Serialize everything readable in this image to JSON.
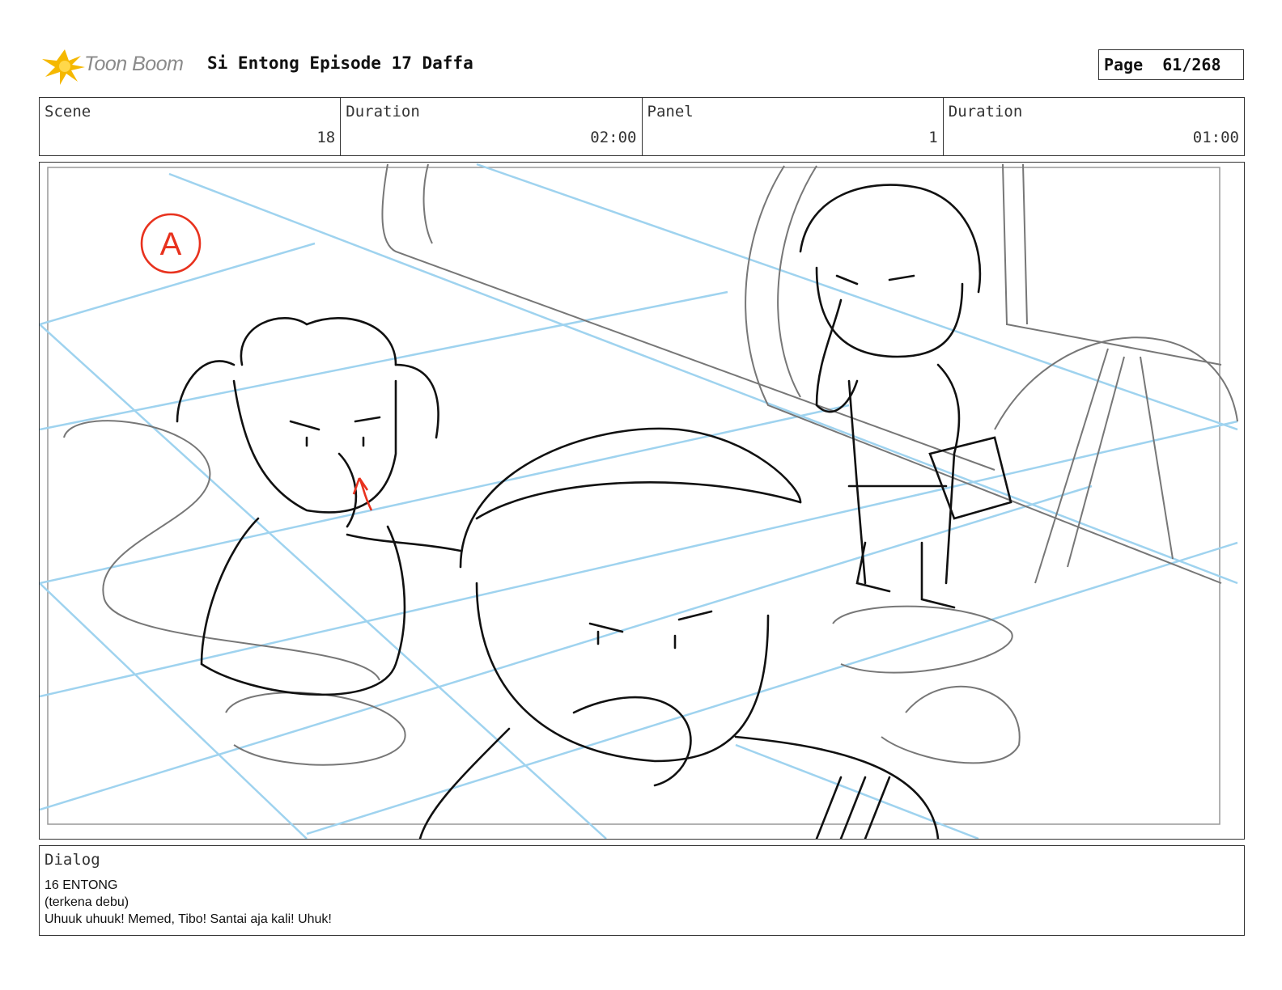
{
  "header": {
    "logo_text": "Toon Boom",
    "title": "Si Entong Episode 17 Daffa",
    "page_label": "Page",
    "page_value": "61/268"
  },
  "info": {
    "scene_label": "Scene",
    "scene_value": "18",
    "scene_duration_label": "Duration",
    "scene_duration_value": "02:00",
    "panel_label": "Panel",
    "panel_value": "1",
    "panel_duration_label": "Duration",
    "panel_duration_value": "01:00"
  },
  "panel_image": {
    "annotation": "A",
    "annotation_color": "#e8321e",
    "guide_color": "#9fd3ef"
  },
  "dialog": {
    "label": "Dialog",
    "lines": [
      "16 ENTONG",
      "(terkena debu)",
      "Uhuuk uhuuk! Memed, Tibo! Santai aja kali! Uhuk!"
    ]
  },
  "colors": {
    "logo_star": "#f5b800",
    "border": "#333333"
  }
}
